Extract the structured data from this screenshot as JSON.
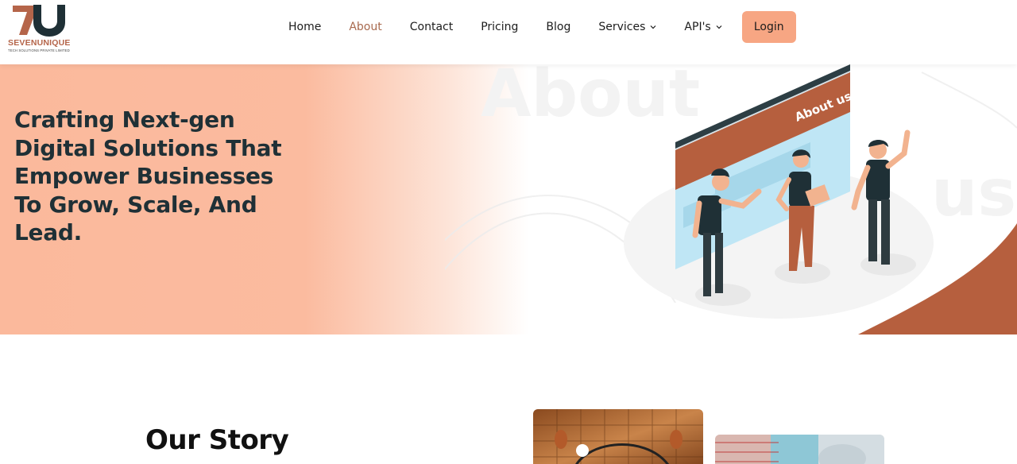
{
  "brand": {
    "name": "SEVENUNIQUE",
    "tagline": "TECH SOLUTIONS PRIVATE LIMITED",
    "colors": {
      "accent": "#f7a683",
      "brand": "#b5654a",
      "active_nav": "#a86a4e",
      "dark": "#1f3036"
    }
  },
  "nav": {
    "items": [
      {
        "label": "Home",
        "active": false,
        "dropdown": false
      },
      {
        "label": "About",
        "active": true,
        "dropdown": false
      },
      {
        "label": "Contact",
        "active": false,
        "dropdown": false
      },
      {
        "label": "Pricing",
        "active": false,
        "dropdown": false
      },
      {
        "label": "Blog",
        "active": false,
        "dropdown": false
      },
      {
        "label": "Services",
        "active": false,
        "dropdown": true
      },
      {
        "label": "API's",
        "active": false,
        "dropdown": true
      }
    ],
    "login_label": "Login"
  },
  "hero": {
    "title": "Crafting Next-gen Digital Solutions That Empower Businesses To Grow, Scale, And Lead.",
    "illustration_banner": "About us",
    "watermark_1": "About",
    "watermark_2": "us"
  },
  "story": {
    "title": "Our Story"
  }
}
